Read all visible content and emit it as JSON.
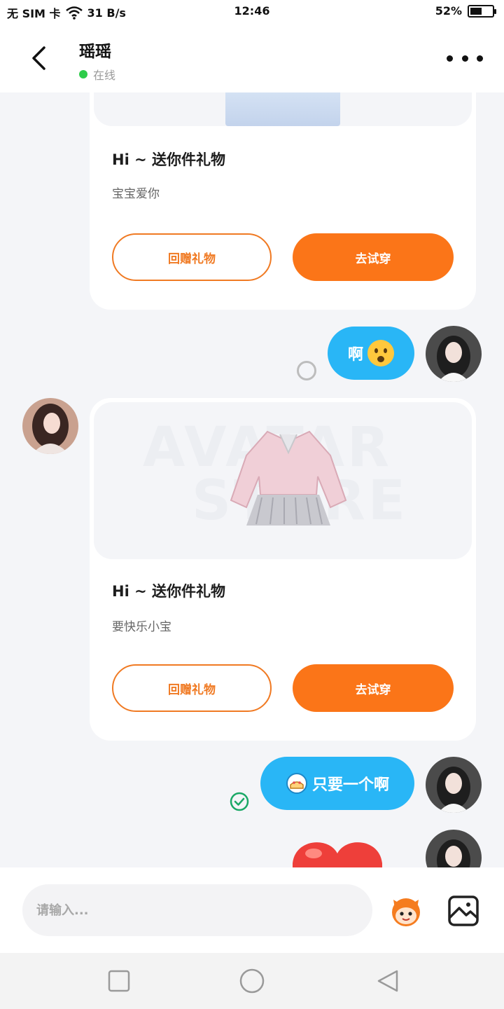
{
  "status_bar": {
    "carrier": "无 SIM 卡",
    "speed": "31 B/s",
    "time": "12:46",
    "battery": "52%",
    "battery_level": 0.52
  },
  "header": {
    "title": "瑶瑶",
    "presence": "在线"
  },
  "messages": [
    {
      "type": "gift",
      "title": "Hi ~ 送你件礼物",
      "note": "宝宝爱你",
      "reply_label": "回赠礼物",
      "try_label": "去试穿"
    },
    {
      "type": "bubble",
      "text": "啊",
      "emoji": "😦",
      "status": "sending"
    },
    {
      "type": "gift",
      "title": "Hi ~ 送你件礼物",
      "note": "要快乐小宝",
      "reply_label": "回赠礼物",
      "try_label": "去试穿",
      "watermark": [
        "AVATAR",
        "STORE"
      ]
    },
    {
      "type": "bubble",
      "text": "只要一个啊",
      "emoji_icon": "cake-icon",
      "status": "read"
    },
    {
      "type": "sticker",
      "icon": "heart-icon"
    }
  ],
  "input": {
    "placeholder": "请输入..."
  },
  "colors": {
    "accent_orange": "#fb7518",
    "bubble_blue": "#29b6f6",
    "online_green": "#2ecc4a"
  }
}
